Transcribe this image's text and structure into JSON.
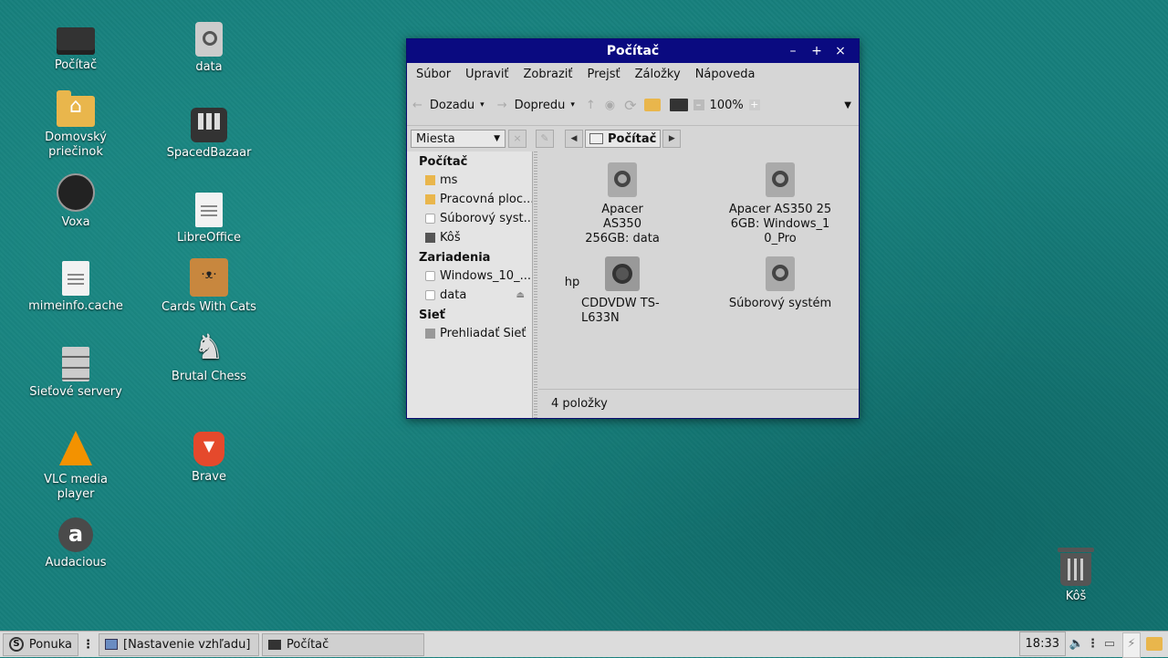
{
  "desktop": {
    "icons": [
      {
        "label": "Počítač",
        "icon": "computer-icon"
      },
      {
        "label": "data",
        "icon": "drive-icon"
      },
      {
        "label": "Domovský priečinok",
        "icon": "home-folder-icon"
      },
      {
        "label": "SpacedBazaar",
        "icon": "spacedbazaar-icon"
      },
      {
        "label": "Voxa",
        "icon": "voxa-icon"
      },
      {
        "label": "LibreOffice",
        "icon": "libreoffice-icon"
      },
      {
        "label": "mimeinfo.cache",
        "icon": "text-file-icon"
      },
      {
        "label": "Cards With Cats",
        "icon": "cat-icon"
      },
      {
        "label": "Sieťové servery",
        "icon": "server-icon"
      },
      {
        "label": "Brutal Chess",
        "icon": "chess-knight-icon"
      },
      {
        "label": "VLC media player",
        "icon": "vlc-cone-icon"
      },
      {
        "label": "Brave",
        "icon": "brave-lion-icon"
      },
      {
        "label": "Audacious",
        "icon": "audacious-icon"
      },
      {
        "label": "Kôš",
        "icon": "trash-icon"
      }
    ]
  },
  "window": {
    "title": "Počítač",
    "controls": {
      "minimize": "–",
      "maximize": "+",
      "close": "×"
    },
    "menu": [
      "Súbor",
      "Upraviť",
      "Zobraziť",
      "Prejsť",
      "Záložky",
      "Nápoveda"
    ],
    "toolbar": {
      "back": "Dozadu",
      "forward": "Dopredu",
      "zoom": "100%",
      "back_arrow": "←",
      "forward_arrow": "→",
      "up_arrow": "↑",
      "stop": "◉",
      "reload": "⟳",
      "zoom_out": "–",
      "zoom_in": "+",
      "dropdown": "▾",
      "overflow": "▼"
    },
    "location": {
      "sidebar_mode": "Miesta",
      "combo_arrow": "▼",
      "close": "×",
      "edit": "✎",
      "prev": "◀",
      "next": "▶",
      "crumb": "Počítač"
    },
    "sidebar": {
      "sections": [
        {
          "title": "Počítač",
          "items": [
            {
              "label": "ms",
              "icon": "home-icon"
            },
            {
              "label": "Pracovná ploc...",
              "icon": "desktop-folder-icon"
            },
            {
              "label": "Súborový syst...",
              "icon": "filesystem-icon"
            },
            {
              "label": "Kôš",
              "icon": "trash-icon"
            }
          ]
        },
        {
          "title": "Zariadenia",
          "items": [
            {
              "label": "Windows_10_...",
              "icon": "drive-icon"
            },
            {
              "label": "data",
              "icon": "drive-icon",
              "eject": "⏏"
            }
          ]
        },
        {
          "title": "Sieť",
          "items": [
            {
              "label": "Prehliadať Sieť",
              "icon": "network-icon"
            }
          ]
        }
      ]
    },
    "files": [
      {
        "label": "Apacer AS350 256GB: data",
        "icon": "drive-icon"
      },
      {
        "label": "Apacer AS350 256GB: Windows_10_Pro",
        "icon": "drive-icon"
      },
      {
        "label": "hp",
        "icon": ""
      },
      {
        "label": "CDDVDW TS-L633N",
        "icon": "optical-drive-icon"
      },
      {
        "label": "Súborový systém",
        "icon": "drive-icon"
      }
    ],
    "status": "4 položky"
  },
  "taskbar": {
    "menu_label": "Ponuka",
    "logo_letter": "S",
    "separator": "⋮",
    "tasks": [
      {
        "label": "[Nastavenie vzhľadu]",
        "icon": "window-icon"
      },
      {
        "label": "Počítač",
        "icon": "monitor-icon"
      }
    ],
    "clock": "18:33",
    "tray": {
      "volume": "🔈",
      "menu": "⋮",
      "display": "▭",
      "power": "⚡"
    }
  }
}
